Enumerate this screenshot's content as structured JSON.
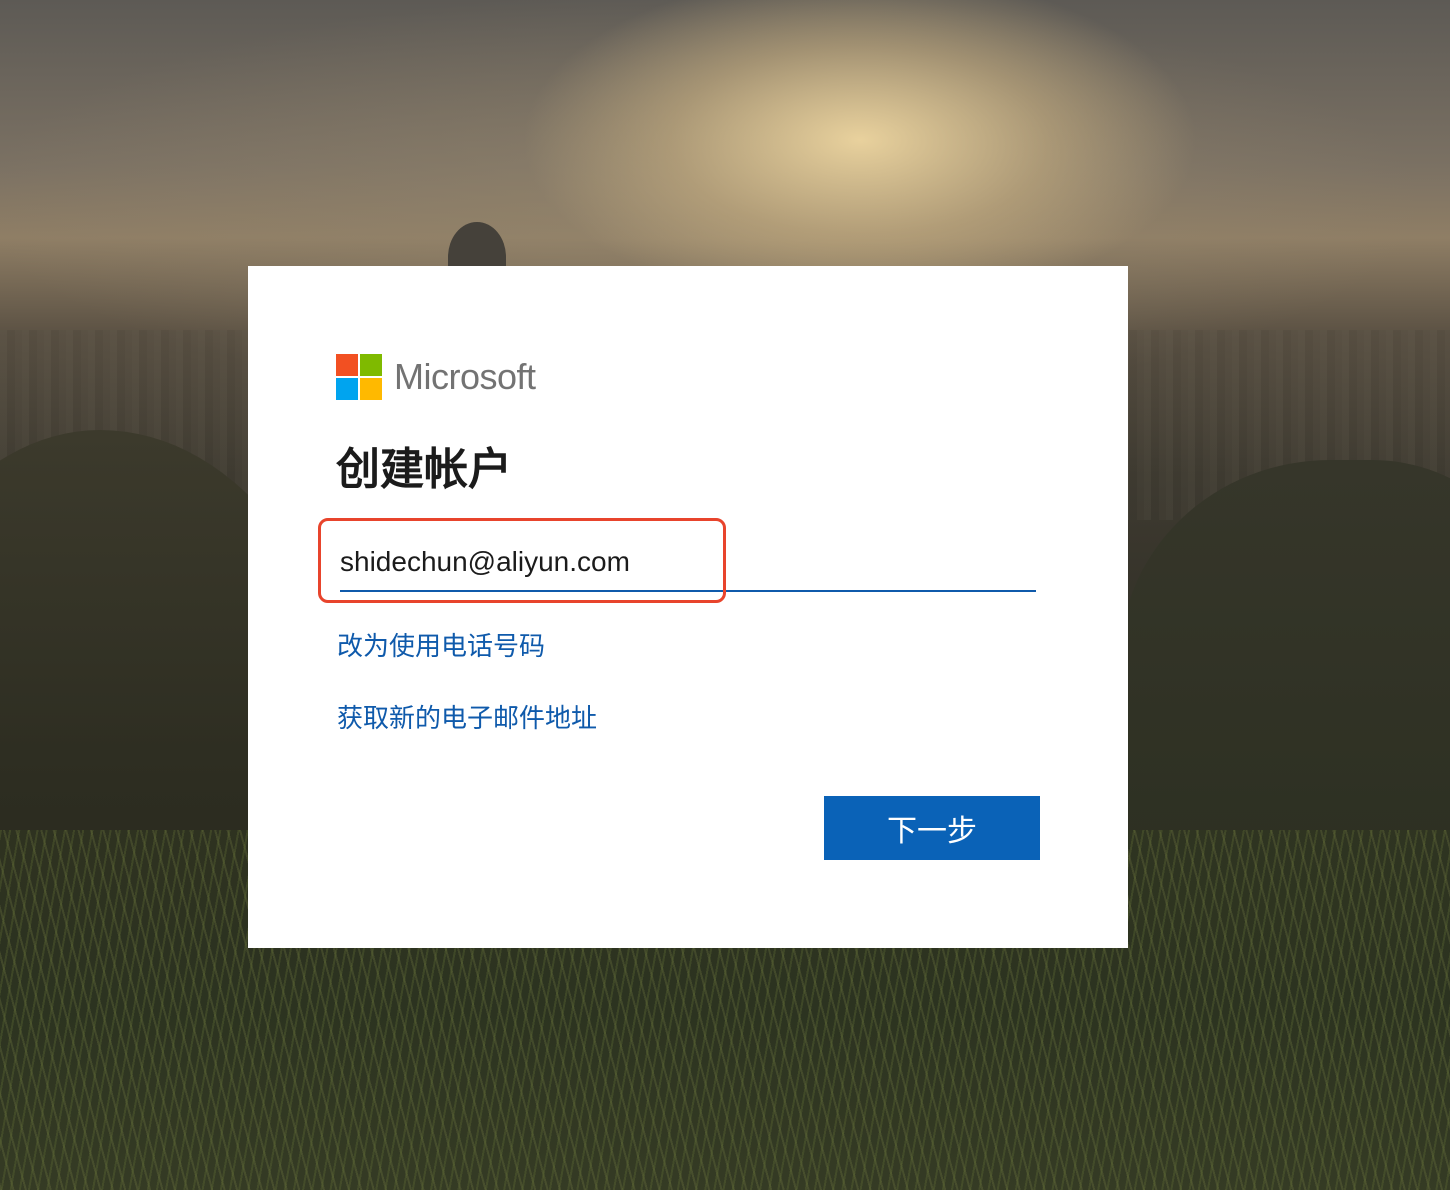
{
  "brand": {
    "name": "Microsoft",
    "logo_colors": [
      "#f25022",
      "#7fba00",
      "#00a4ef",
      "#ffb900"
    ]
  },
  "dialog": {
    "title": "创建帐户",
    "email_value": "shidechun@aliyun.com",
    "use_phone_link": "改为使用电话号码",
    "new_email_link": "获取新的电子邮件地址",
    "next_button": "下一步"
  },
  "colors": {
    "accent": "#0a62b7",
    "link": "#0f5aab",
    "annotation_outline": "#e8442c"
  }
}
